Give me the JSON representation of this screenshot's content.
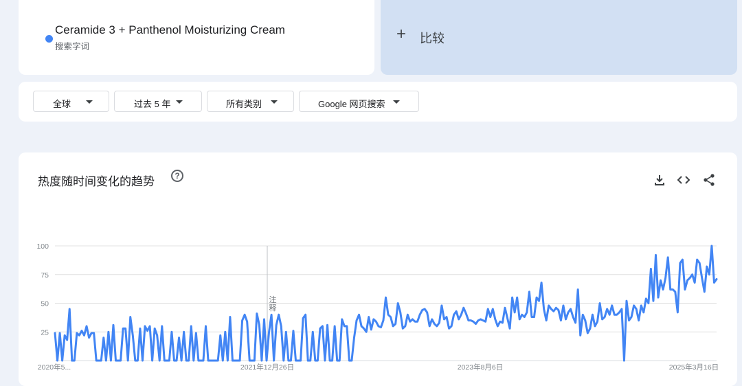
{
  "term": {
    "name": "Ceramide 3 + Panthenol Moisturizing Cream",
    "type_label": "搜索字词",
    "color": "#4285f4"
  },
  "compare": {
    "plus": "+",
    "label": "比较"
  },
  "filters": [
    {
      "label": "全球"
    },
    {
      "label": "过去 5 年"
    },
    {
      "label": "所有类别"
    },
    {
      "label": "Google 网页搜索"
    }
  ],
  "chart_section": {
    "title": "热度随时间变化的趋势",
    "help_icon": "question-circle-icon",
    "tools": [
      "download-icon",
      "embed-code-icon",
      "share-icon"
    ]
  },
  "chart_data": {
    "type": "line",
    "series": [
      {
        "color": "#4285f4",
        "values": [
          24,
          0,
          24,
          0,
          22,
          18,
          45,
          0,
          0,
          24,
          22,
          26,
          22,
          30,
          20,
          24,
          24,
          0,
          0,
          0,
          20,
          0,
          25,
          0,
          31,
          0,
          0,
          0,
          28,
          28,
          0,
          38,
          22,
          0,
          0,
          28,
          0,
          30,
          26,
          30,
          0,
          28,
          22,
          0,
          30,
          0,
          0,
          0,
          25,
          0,
          0,
          20,
          0,
          25,
          0,
          0,
          30,
          0,
          24,
          0,
          0,
          0,
          30,
          0,
          0,
          0,
          0,
          0,
          22,
          0,
          25,
          0,
          38,
          0,
          0,
          0,
          0,
          35,
          40,
          34,
          0,
          0,
          0,
          41,
          31,
          0,
          36,
          0,
          25,
          40,
          0,
          31,
          40,
          30,
          0,
          25,
          0,
          0,
          26,
          0,
          0,
          0,
          37,
          40,
          0,
          0,
          25,
          0,
          0,
          28,
          30,
          0,
          31,
          0,
          0,
          30,
          0,
          0,
          36,
          30,
          30,
          0,
          0,
          20,
          35,
          40,
          30,
          28,
          25,
          38,
          27,
          36,
          34,
          30,
          29,
          35,
          55,
          40,
          38,
          30,
          32,
          50,
          42,
          28,
          30,
          40,
          34,
          36,
          34,
          34,
          40,
          44,
          45,
          42,
          30,
          36,
          32,
          30,
          33,
          48,
          36,
          38,
          28,
          30,
          40,
          43,
          36,
          40,
          46,
          41,
          35,
          35,
          34,
          32,
          35,
          36,
          35,
          34,
          45,
          38,
          45,
          36,
          30,
          34,
          33,
          46,
          37,
          28,
          55,
          42,
          55,
          36,
          40,
          38,
          42,
          60,
          38,
          38,
          55,
          52,
          68,
          45,
          35,
          48,
          45,
          43,
          46,
          44,
          35,
          48,
          36,
          42,
          45,
          38,
          33,
          62,
          22,
          40,
          35,
          24,
          28,
          40,
          30,
          34,
          50,
          36,
          38,
          45,
          40,
          48,
          40,
          40,
          42,
          45,
          0,
          52,
          35,
          38,
          48,
          45,
          35,
          48,
          42,
          54,
          50,
          80,
          52,
          92,
          55,
          70,
          62,
          72,
          90,
          62,
          62,
          60,
          42,
          85,
          88,
          62,
          70,
          72,
          75,
          68,
          88,
          85,
          72,
          60,
          82,
          75,
          100,
          68,
          71
        ],
        "max_value": 100
      }
    ],
    "yticks": [
      "100",
      "75",
      "50",
      "25"
    ],
    "ylim": [
      0,
      100
    ],
    "xticks": [
      "2020年5...",
      "2021年12月26日",
      "2023年8月6日",
      "2025年3月16日"
    ],
    "annotation": "注释",
    "grid": true
  }
}
